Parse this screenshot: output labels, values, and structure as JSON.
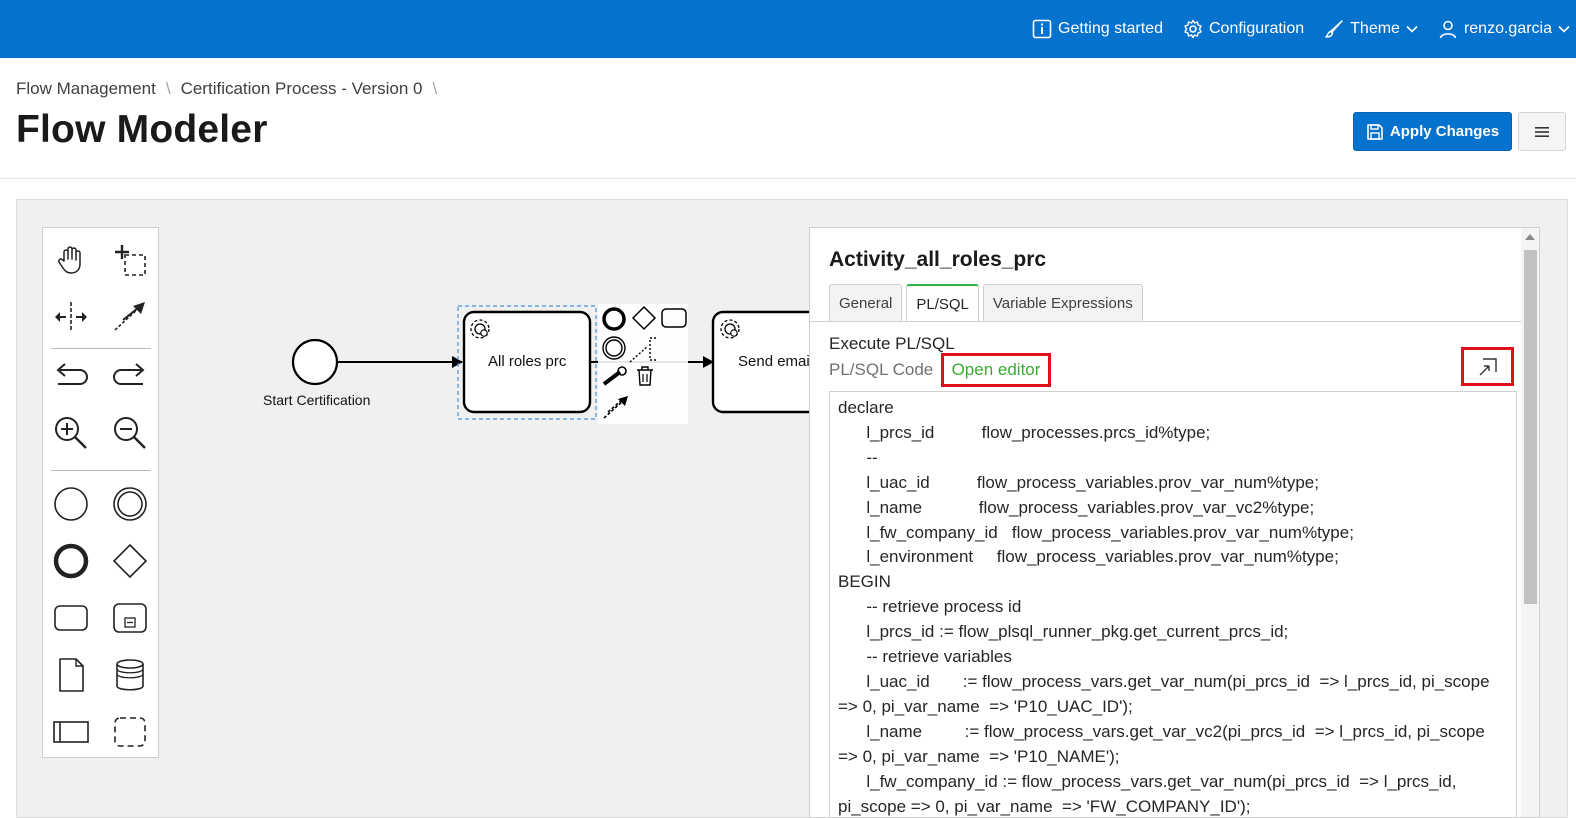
{
  "topnav": {
    "getting_started": "Getting started",
    "configuration": "Configuration",
    "theme": "Theme",
    "user": "renzo.garcia"
  },
  "breadcrumb": {
    "items": [
      "Flow Management",
      "Certification Process - Version 0"
    ]
  },
  "page": {
    "title": "Flow Modeler",
    "apply_label": "Apply Changes"
  },
  "diagram": {
    "start_label": "Start Certification",
    "task1_label": "All roles prc",
    "task2_label": "Send emai"
  },
  "panel": {
    "title": "Activity_all_roles_prc",
    "tabs": [
      "General",
      "PL/SQL",
      "Variable Expressions"
    ],
    "active_tab": "PL/SQL",
    "section_label": "Execute PL/SQL",
    "code_label": "PL/SQL Code",
    "open_editor": "Open editor",
    "code_lines": [
      "declare",
      "      l_prcs_id          flow_processes.prcs_id%type;",
      "      --",
      "      l_uac_id          flow_process_variables.prov_var_num%type;",
      "      l_name            flow_process_variables.prov_var_vc2%type;",
      "      l_fw_company_id   flow_process_variables.prov_var_num%type;",
      "      l_environment     flow_process_variables.prov_var_num%type;",
      "BEGIN",
      "      -- retrieve process id",
      "      l_prcs_id := flow_plsql_runner_pkg.get_current_prcs_id;",
      "      -- retrieve variables",
      "      l_uac_id       := flow_process_vars.get_var_num(pi_prcs_id  => l_prcs_id, pi_scope => 0, pi_var_name  => 'P10_UAC_ID');",
      "      l_name         := flow_process_vars.get_var_vc2(pi_prcs_id  => l_prcs_id, pi_scope => 0, pi_var_name  => 'P10_NAME');",
      "      l_fw_company_id := flow_process_vars.get_var_num(pi_prcs_id  => l_prcs_id, pi_scope => 0, pi_var_name  => 'FW_COMPANY_ID');"
    ]
  },
  "colors": {
    "brand": "#0572ce",
    "highlight": "#e0101a",
    "link_green": "#3aa935"
  }
}
